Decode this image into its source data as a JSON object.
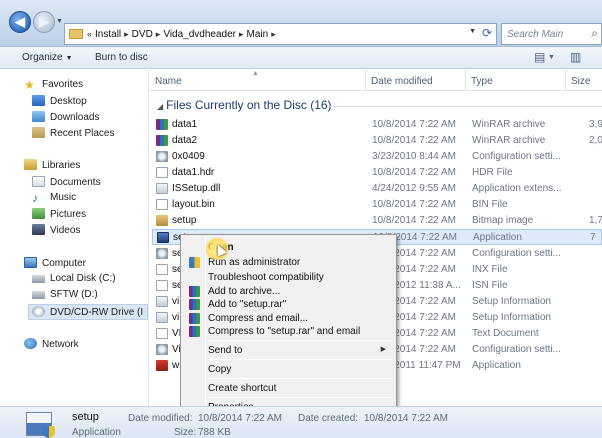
{
  "address": {
    "chevron": "«",
    "segments": [
      "Install",
      "DVD",
      "Vida_dvdheader",
      "Main"
    ],
    "separator": "▸",
    "search_placeholder": "Search Main"
  },
  "toolbar": {
    "organize_label": "Organize",
    "burn_label": "Burn to disc"
  },
  "sidebar": {
    "favorites": "Favorites",
    "desktop": "Desktop",
    "downloads": "Downloads",
    "recent": "Recent Places",
    "libraries": "Libraries",
    "documents": "Documents",
    "music": "Music",
    "pictures": "Pictures",
    "videos": "Videos",
    "computer": "Computer",
    "local_disk": "Local Disk (C:)",
    "sftw": "SFTW (D:)",
    "dvd_drive": "DVD/CD-RW Drive (I",
    "network": "Network"
  },
  "columns": {
    "name": "Name",
    "date": "Date modified",
    "type": "Type",
    "size": "Size"
  },
  "group_label": "Files Currently on the Disc (16)",
  "files": [
    {
      "name": "data1",
      "date": "10/8/2014 7:22 AM",
      "type": "WinRAR archive",
      "size": "3,9"
    },
    {
      "name": "data2",
      "date": "10/8/2014 7:22 AM",
      "type": "WinRAR archive",
      "size": "2,0"
    },
    {
      "name": "0x0409",
      "date": "3/23/2010 8:44 AM",
      "type": "Configuration setti...",
      "size": ""
    },
    {
      "name": "data1.hdr",
      "date": "10/8/2014 7:22 AM",
      "type": "HDR File",
      "size": ""
    },
    {
      "name": "ISSetup.dll",
      "date": "4/24/2012 9:55 AM",
      "type": "Application extens...",
      "size": ""
    },
    {
      "name": "layout.bin",
      "date": "10/8/2014 7:22 AM",
      "type": "BIN File",
      "size": ""
    },
    {
      "name": "setup",
      "date": "10/8/2014 7:22 AM",
      "type": "Bitmap image",
      "size": "1,7"
    },
    {
      "name": "setup",
      "date": "10/8/2014 7:22 AM",
      "type": "Application",
      "size": "7"
    },
    {
      "name": "se",
      "date": "10/8/2014 7:22 AM",
      "type": "Configuration setti...",
      "size": ""
    },
    {
      "name": "se",
      "date": "10/8/2014 7:22 AM",
      "type": "INX File",
      "size": ""
    },
    {
      "name": "se",
      "date": "10/8/2012 11:38 A...",
      "type": "ISN File",
      "size": ""
    },
    {
      "name": "vi",
      "date": "10/8/2014 7:22 AM",
      "type": "Setup Information",
      "size": ""
    },
    {
      "name": "vi",
      "date": "10/8/2014 7:22 AM",
      "type": "Setup Information",
      "size": ""
    },
    {
      "name": "VI",
      "date": "10/8/2014 7:22 AM",
      "type": "Text Document",
      "size": ""
    },
    {
      "name": "Vi",
      "date": "10/8/2014 7:22 AM",
      "type": "Configuration setti...",
      "size": ""
    },
    {
      "name": "ws",
      "date": "10/8/2011 11:47 PM",
      "type": "Application",
      "size": ""
    }
  ],
  "context_menu": {
    "open": "Open",
    "run_admin": "Run as administrator",
    "troubleshoot": "Troubleshoot compatibility",
    "add_archive": "Add to archive...",
    "add_rar": "Add to \"setup.rar\"",
    "compress_email": "Compress and email...",
    "compress_rar_email": "Compress to \"setup.rar\" and email",
    "send_to": "Send to",
    "copy": "Copy",
    "create_shortcut": "Create shortcut",
    "properties": "Properties"
  },
  "details": {
    "name": "setup",
    "kind": "Application",
    "date_modified_label": "Date modified:",
    "date_modified": "10/8/2014 7:22 AM",
    "date_created_label": "Date created:",
    "date_created": "10/8/2014 7:22 AM",
    "size_label": "Size:",
    "size": "788 KB"
  }
}
